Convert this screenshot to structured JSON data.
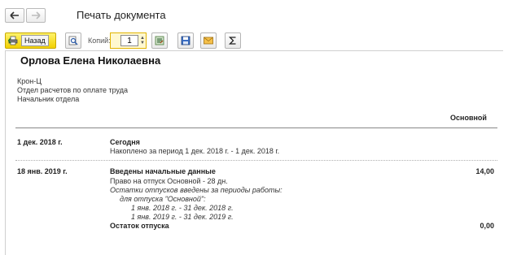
{
  "window": {
    "title": "Печать документа"
  },
  "toolbar": {
    "back_label": "Назад",
    "copies_label": "Копий:",
    "copies_value": "1"
  },
  "icons": {
    "nav_back": "arrow-left-icon",
    "nav_forward": "arrow-right-icon",
    "back": "printer-icon",
    "preview": "magnifier-icon",
    "settings": "print-settings-icon",
    "save": "floppy-disk-icon",
    "mail": "envelope-icon",
    "sum": "sigma-icon"
  },
  "document": {
    "employee_name": "Орлова Елена Николаевна",
    "organization": "Крон-Ц",
    "department": "Отдел расчетов по оплате труда",
    "position": "Начальник отдела",
    "column_header": "Основной",
    "entries": [
      {
        "date": "1 дек. 2018 г.",
        "title": "Сегодня",
        "line": "Накоплено за период 1 дек. 2018 г. - 1 дек. 2018 г."
      },
      {
        "date": "18 янв. 2019 г.",
        "title": "Введены начальные данные",
        "value": "14,00",
        "lines": [
          "Право на отпуск Основной - 28 дн.",
          "Остатки отпусков введены за периоды работы:",
          "для отпуска \"Основной\":",
          "1 янв. 2018 г. - 31 дек. 2018 г.",
          "1 янв. 2019 г. - 31 дек. 2019 г."
        ]
      }
    ],
    "total_label": "Остаток отпуска",
    "total_value": "0,00"
  },
  "colors": {
    "accent_yellow": "#f2d000",
    "field_border": "#e2b400"
  }
}
